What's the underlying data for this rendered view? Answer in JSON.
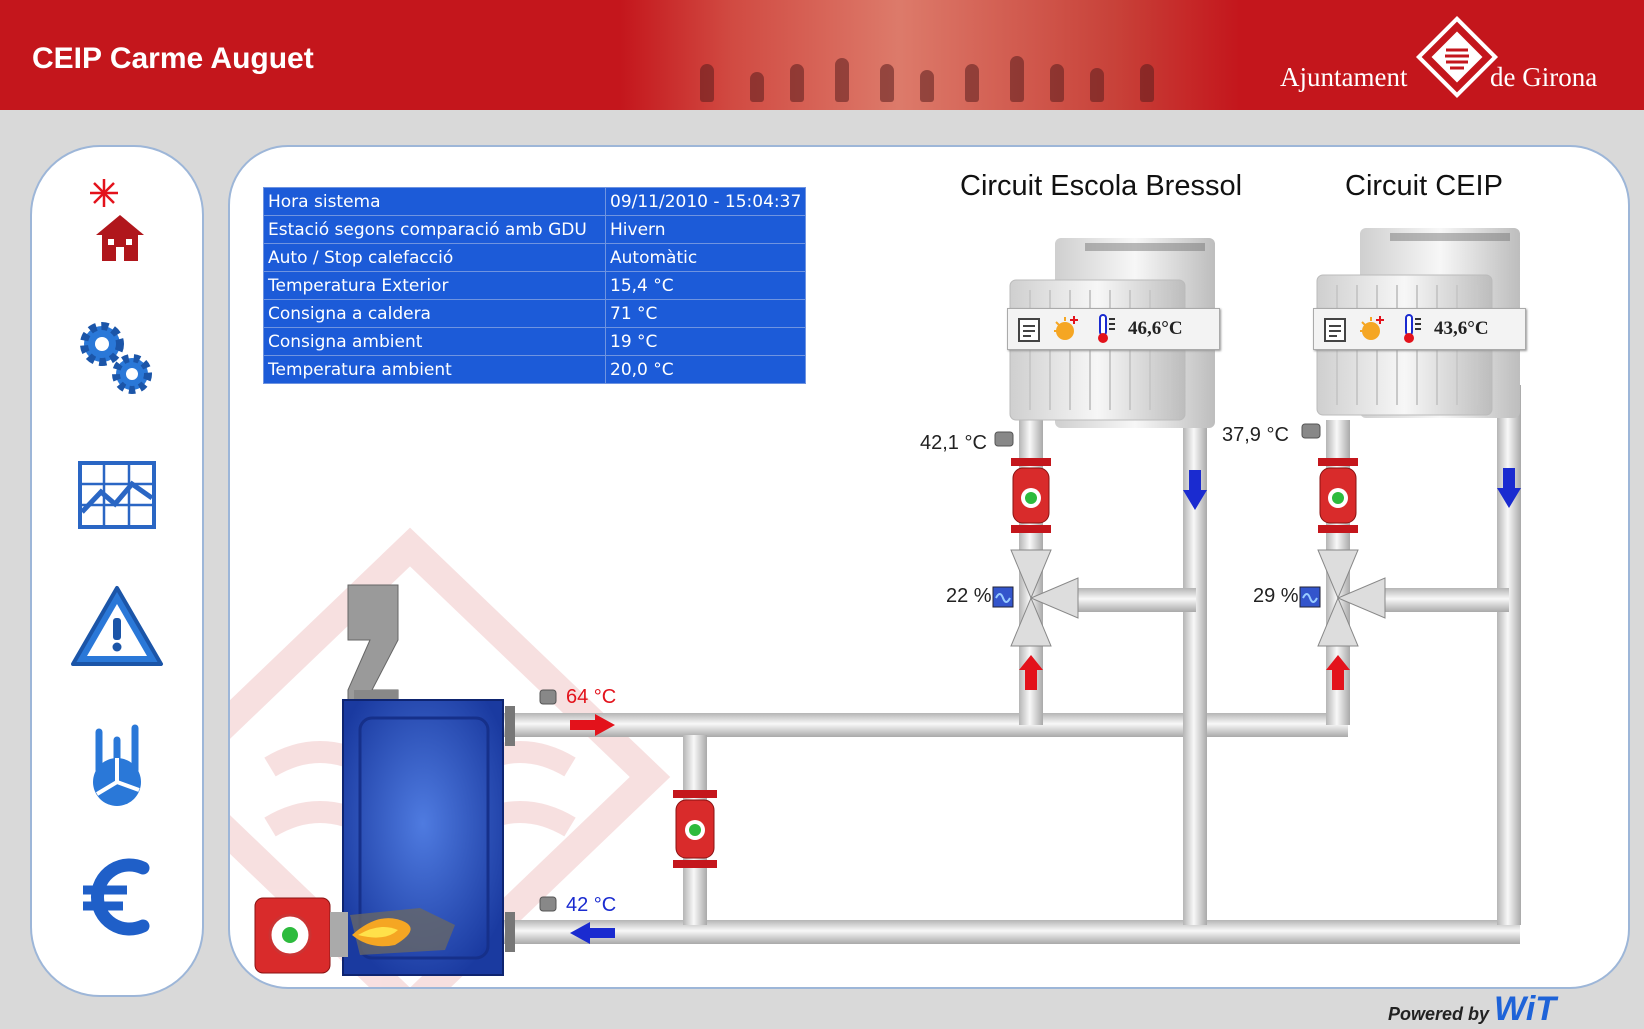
{
  "header": {
    "title": "CEIP Carme Auguet",
    "logo_left": "Ajuntament",
    "logo_right": "de Girona"
  },
  "sidebar": {
    "items": [
      {
        "name": "home-icon"
      },
      {
        "name": "settings-gears-icon"
      },
      {
        "name": "chart-icon"
      },
      {
        "name": "alarm-warning-icon"
      },
      {
        "name": "consumption-icon"
      },
      {
        "name": "euro-icon"
      }
    ]
  },
  "info_table": {
    "rows": [
      {
        "label": "Hora sistema",
        "value": "09/11/2010 - 15:04:37"
      },
      {
        "label": "Estació segons comparació amb GDU",
        "value": "Hivern"
      },
      {
        "label": "Auto / Stop calefacció",
        "value": "Automàtic"
      },
      {
        "label": "Temperatura Exterior",
        "value": "15,4 °C"
      },
      {
        "label": "Consigna a caldera",
        "value": "71 °C"
      },
      {
        "label": "Consigna ambient",
        "value": "19 °C"
      },
      {
        "label": "Temperatura ambient",
        "value": "20,0 °C"
      }
    ]
  },
  "circuits": [
    {
      "title": "Circuit Escola Bressol",
      "room_temp": "46,6°C",
      "flow_temp": "42,1 °C",
      "valve": "22 %"
    },
    {
      "title": "Circuit CEIP",
      "room_temp": "43,6°C",
      "flow_temp": "37,9 °C",
      "valve": "29 %"
    }
  ],
  "boiler": {
    "supply_temp": "64 °C",
    "return_temp": "42 °C"
  },
  "footer": {
    "powered_by": "Powered by",
    "brand": "WiT"
  },
  "colors": {
    "header_red": "#c4161c",
    "table_blue": "#1c5bd8",
    "boiler_blue": "#1f3fa8",
    "pipe_grey": "#e8e8e8",
    "supply_red": "#e3121b",
    "return_blue": "#1a2bd0"
  }
}
